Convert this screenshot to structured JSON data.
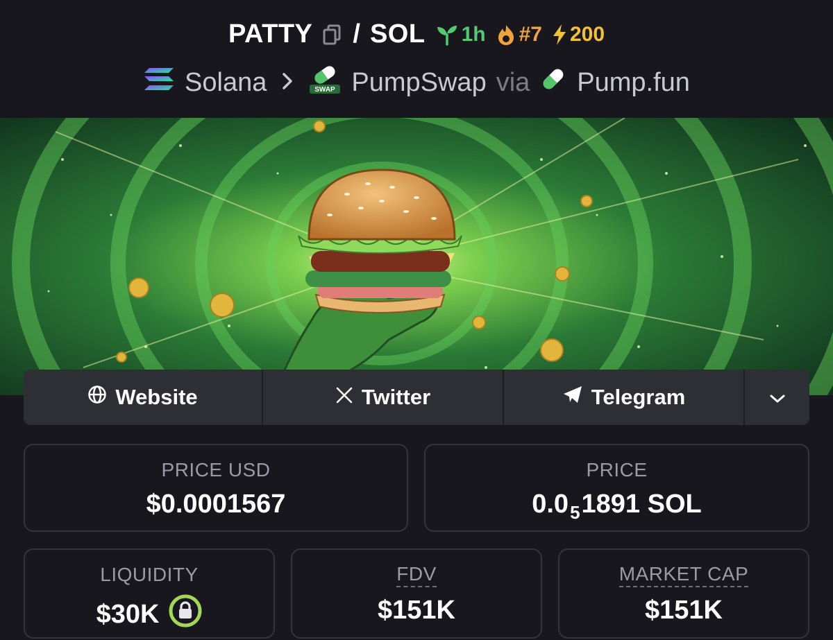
{
  "header": {
    "base_symbol": "PATTY",
    "slash": "/",
    "quote_symbol": "SOL",
    "age": "1h",
    "rank": "#7",
    "boosts": "200",
    "chain": "Solana",
    "dex": "PumpSwap",
    "via": "via",
    "launchpad": "Pump.fun",
    "dex_badge_text": "SWAP"
  },
  "socials": {
    "website": "Website",
    "twitter": "Twitter",
    "telegram": "Telegram"
  },
  "stats": {
    "price_usd_label": "PRICE USD",
    "price_usd_value": "$0.0001567",
    "price_label": "PRICE",
    "price_prefix": "0.0",
    "price_zero_count": "5",
    "price_suffix": "1891 SOL",
    "liquidity_label": "LIQUIDITY",
    "liquidity_value": "$30K",
    "fdv_label": "FDV",
    "fdv_value": "$151K",
    "mcap_label": "MARKET CAP",
    "mcap_value": "$151K"
  },
  "colors": {
    "background": "#17171d",
    "age_green": "#55c96f",
    "rank_orange": "#f2a23a",
    "boost_yellow": "#f1c232",
    "lock_green": "#a6d656"
  },
  "icons": [
    "copy-icon",
    "sprout-icon",
    "flame-icon",
    "lightning-icon",
    "solana-logo-icon",
    "chevron-right-icon",
    "pumpswap-pill-icon",
    "pump-pill-icon",
    "globe-icon",
    "x-logo-icon",
    "telegram-icon",
    "chevron-down-icon",
    "lock-icon"
  ]
}
